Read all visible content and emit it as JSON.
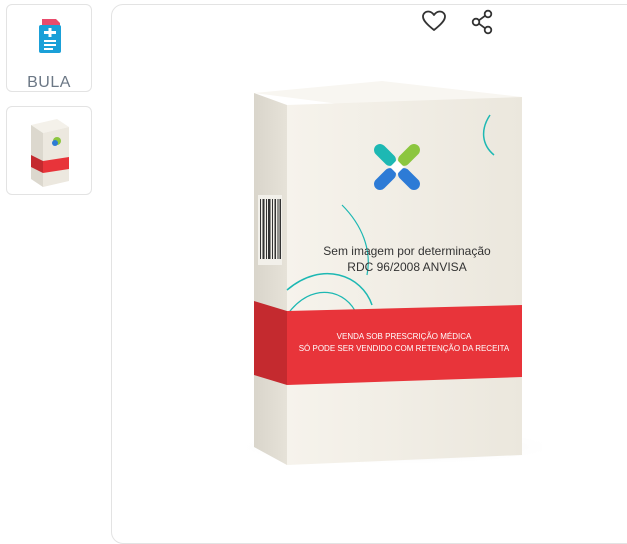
{
  "gallery": {
    "bula_label": "BULA",
    "bula_icon": "document-icon",
    "product_thumb_icon": "product-box-icon"
  },
  "actions": {
    "favorite_icon": "heart-icon",
    "share_icon": "share-icon"
  },
  "product_image": {
    "notice_line1": "Sem imagem por determinação",
    "notice_line2": "RDC 96/2008 ANVISA",
    "band_line1": "VENDA SOB PRESCRIÇÃO MÉDICA",
    "band_line2": "SÓ PODE SER VENDIDO COM RETENÇÃO DA RECEITA"
  },
  "colors": {
    "accent_red": "#e8343a",
    "bula_blue": "#1aa0d8",
    "bula_pink": "#e94b6c",
    "logo_green": "#8cc63f",
    "logo_blue": "#2d7bd6",
    "logo_teal": "#1db8b3"
  }
}
